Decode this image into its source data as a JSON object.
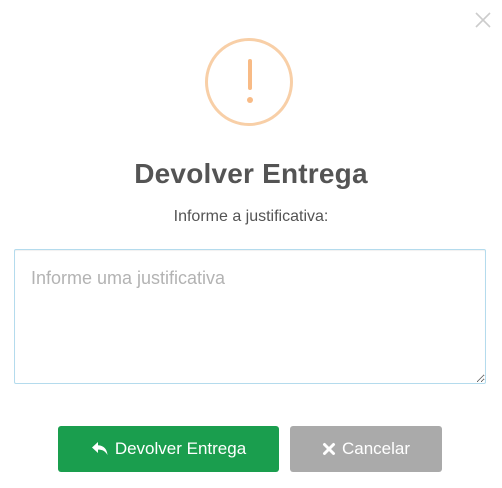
{
  "dialog": {
    "title": "Devolver Entrega",
    "subtitle": "Informe a justificativa:",
    "warning_icon": "exclamation-circle-icon",
    "close_icon": "close-icon",
    "accent_warning": "#f8bb86"
  },
  "justification_input": {
    "placeholder": "Informe uma justificativa",
    "value": ""
  },
  "actions": {
    "confirm_label": "Devolver Entrega",
    "confirm_icon": "reply-icon",
    "confirm_color": "#1a9e4e",
    "cancel_label": "Cancelar",
    "cancel_icon": "times-icon",
    "cancel_color": "#aaaaaa"
  }
}
